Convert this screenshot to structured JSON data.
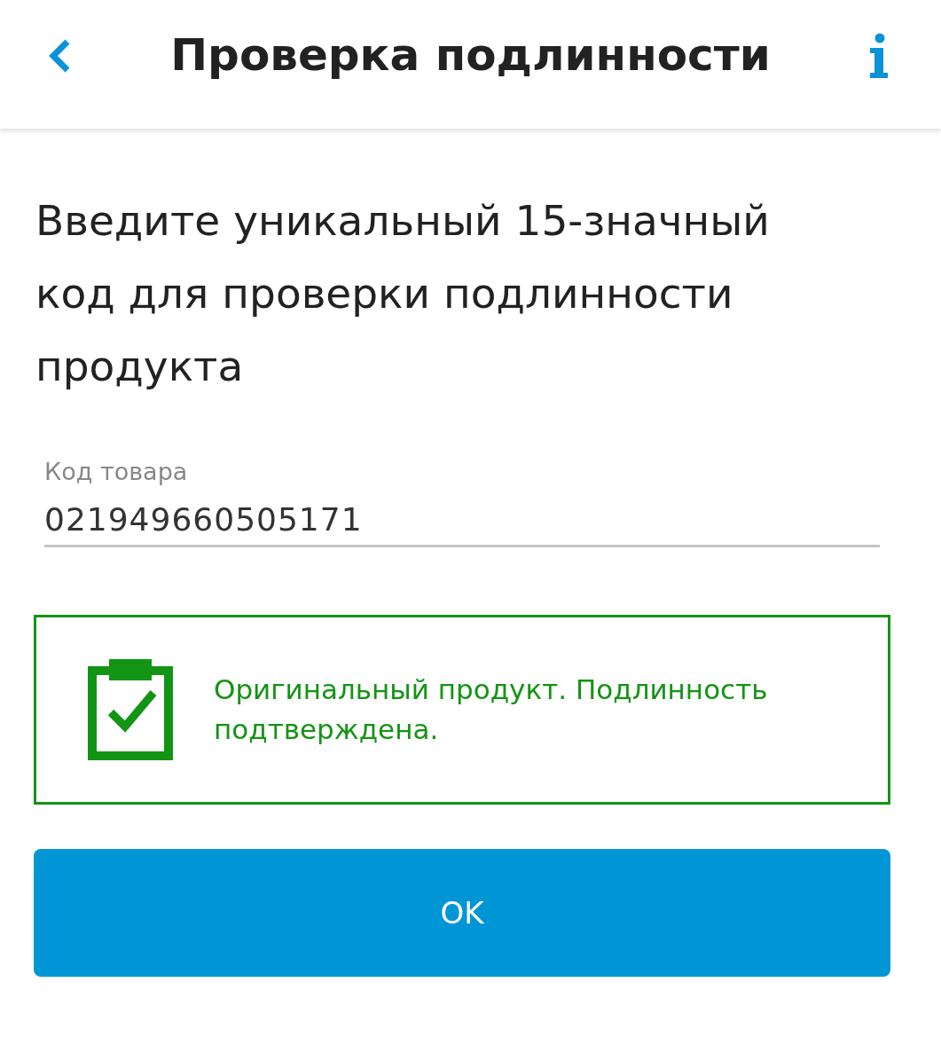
{
  "header": {
    "title": "Проверка подлинности"
  },
  "instruction": "Введите уникальный 15-значный код для проверки подлинности продукта",
  "field": {
    "label": "Код товара",
    "value": "021949660505171"
  },
  "status": {
    "kind": "success",
    "text": "Оригинальный продукт. Подлинность подтверждена."
  },
  "button": {
    "label": "OK"
  }
}
